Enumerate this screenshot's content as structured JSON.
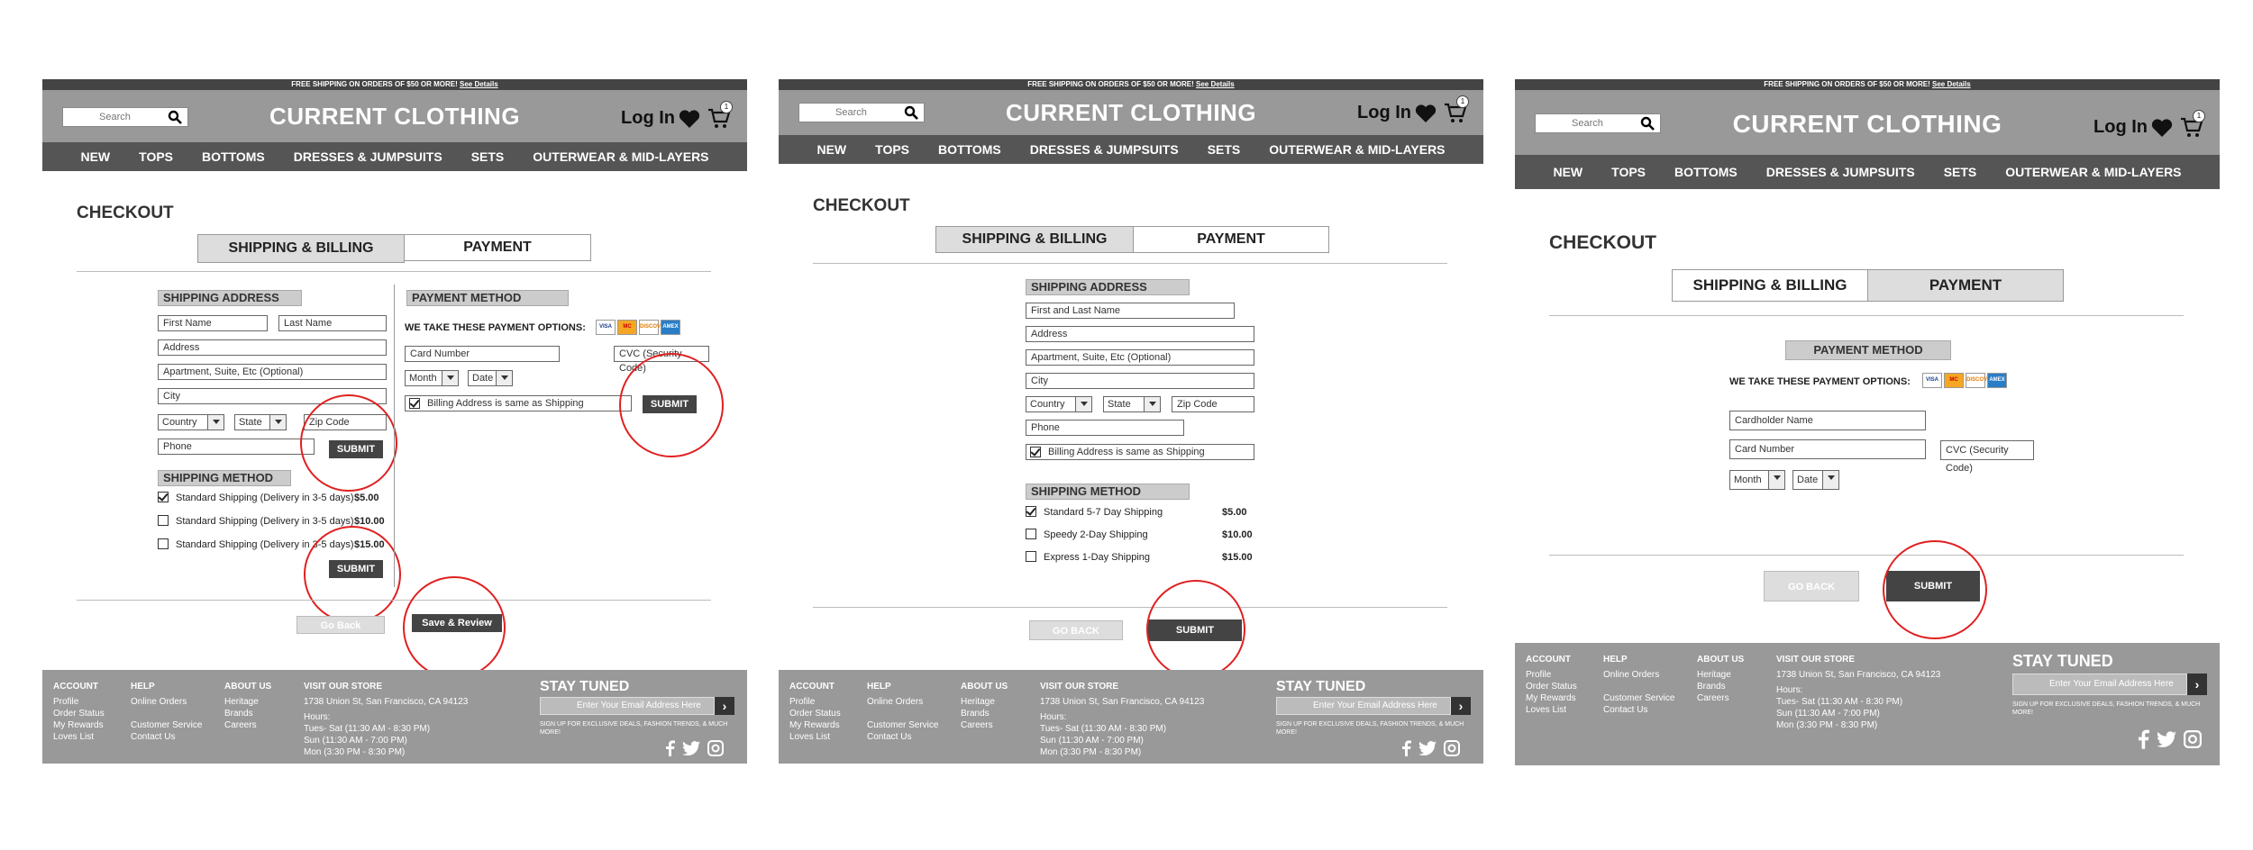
{
  "site": {
    "promo": "FREE SHIPPING ON ORDERS OF $50 OR MORE!",
    "promo_link": "See Details",
    "brand": "CURRENT CLOTHING",
    "search_placeholder": "Search",
    "login": "Log In",
    "cart_count": "1",
    "nav": [
      "NEW",
      "TOPS",
      "BOTTOMS",
      "DRESSES & JUMPSUITS",
      "SETS",
      "OUTERWEAR & MID-LAYERS"
    ]
  },
  "checkout": {
    "title": "CHECKOUT",
    "tab_shipping": "SHIPPING & BILLING",
    "tab_payment": "PAYMENT"
  },
  "shipping": {
    "section": "SHIPPING ADDRESS",
    "first_name": "First Name",
    "last_name": "Last Name",
    "full_name": "First and Last Name",
    "address": "Address",
    "apartment": "Apartment, Suite, Etc (Optional)",
    "city": "City",
    "country": "Country",
    "state": "State",
    "zip": "Zip Code",
    "phone": "Phone",
    "billing_same": "Billing Address is same as Shipping"
  },
  "method": {
    "section": "SHIPPING METHOD",
    "v1_options": [
      {
        "label": "Standard Shipping (Delivery in 3-5 days)",
        "price": "$5.00",
        "checked": true
      },
      {
        "label": "Standard Shipping (Delivery in 3-5 days)",
        "price": "$10.00",
        "checked": false
      },
      {
        "label": "Standard Shipping (Delivery in 3-5 days)",
        "price": "$15.00",
        "checked": false
      }
    ],
    "v2_options": [
      {
        "label": "Standard 5-7 Day Shipping",
        "price": "$5.00",
        "checked": true
      },
      {
        "label": "Speedy 2-Day Shipping",
        "price": "$10.00",
        "checked": false
      },
      {
        "label": "Express 1-Day Shipping",
        "price": "$15.00",
        "checked": false
      }
    ]
  },
  "payment": {
    "section": "PAYMENT METHOD",
    "accepted": "WE TAKE THESE PAYMENT OPTIONS:",
    "cards": [
      "VISA",
      "MC",
      "DISCOVER",
      "AMEX"
    ],
    "cardholder": "Cardholder Name",
    "card_number": "Card Number",
    "cvc": "CVC (Security Code)",
    "month": "Month",
    "date": "Date"
  },
  "buttons": {
    "submit": "SUBMIT",
    "go_back": "Go Back",
    "go_back_caps": "GO BACK",
    "save_review": "Save & Review"
  },
  "footer": {
    "account_title": "ACCOUNT",
    "account": [
      "Profile",
      "Order Status",
      "My Rewards",
      "Loves List"
    ],
    "help_title": "HELP",
    "help1": "Online Orders",
    "help2": [
      "Customer Service",
      "Contact Us"
    ],
    "about_title": "ABOUT US",
    "about": [
      "Heritage",
      "Brands",
      "Careers"
    ],
    "store_title": "VISIT OUR STORE",
    "address": "1738 Union St, San Francisco, CA 94123",
    "hours_title": "Hours:",
    "hours": [
      "Tues- Sat (11:30 AM - 8:30 PM)",
      "Sun (11:30 AM - 7:00 PM)",
      "Mon (3:30 PM - 8:30 PM)"
    ],
    "stay": "STAY TUNED",
    "email_placeholder": "Enter Your Email Address Here",
    "signup": "SIGN UP FOR EXCLUSIVE DEALS, FASHION TRENDS, & MUCH MORE!",
    "social_icons": [
      "facebook-icon",
      "twitter-icon",
      "instagram-icon"
    ]
  },
  "colors": {
    "annotation": "#e02020",
    "header": "#999999",
    "nav": "#555555",
    "button": "#444444"
  }
}
